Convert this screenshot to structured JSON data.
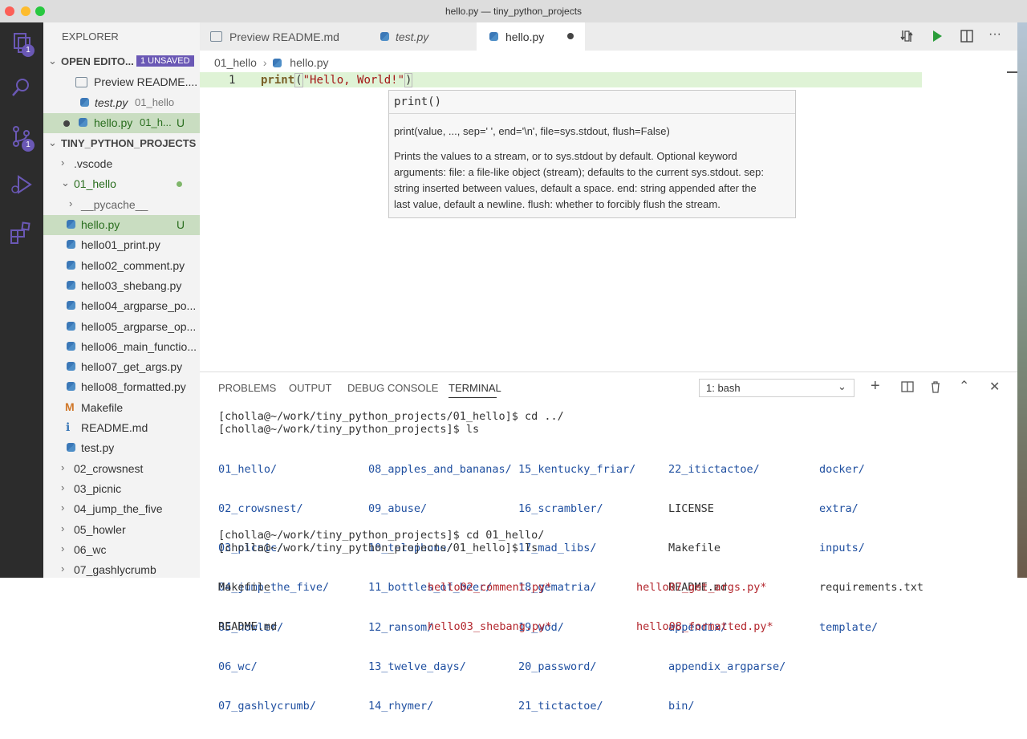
{
  "window": {
    "title": "hello.py — tiny_python_projects"
  },
  "activity": {
    "explorer_badge": "1",
    "scm_badge": "1"
  },
  "sidebar": {
    "header": "EXPLORER",
    "open_editors": {
      "label": "OPEN EDITO...",
      "unsaved_badge": "1 UNSAVED",
      "items": [
        {
          "name": "Preview README....",
          "detail": "",
          "status": ""
        },
        {
          "name": "test.py",
          "detail": "01_hello",
          "status": ""
        },
        {
          "name": "hello.py",
          "detail": "01_h...",
          "status": "U"
        }
      ]
    },
    "project": {
      "label": "TINY_PYTHON_PROJECTS",
      "items": [
        {
          "name": ".vscode"
        },
        {
          "name": "01_hello"
        },
        {
          "name": "__pycache__"
        },
        {
          "name": "hello.py",
          "status": "U"
        },
        {
          "name": "hello01_print.py"
        },
        {
          "name": "hello02_comment.py"
        },
        {
          "name": "hello03_shebang.py"
        },
        {
          "name": "hello04_argparse_po..."
        },
        {
          "name": "hello05_argparse_op..."
        },
        {
          "name": "hello06_main_functio..."
        },
        {
          "name": "hello07_get_args.py"
        },
        {
          "name": "hello08_formatted.py"
        },
        {
          "name": "Makefile"
        },
        {
          "name": "README.md"
        },
        {
          "name": "test.py"
        },
        {
          "name": "02_crowsnest"
        },
        {
          "name": "03_picnic"
        },
        {
          "name": "04_jump_the_five"
        },
        {
          "name": "05_howler"
        },
        {
          "name": "06_wc"
        },
        {
          "name": "07_gashlycrumb"
        }
      ]
    }
  },
  "tabs": [
    {
      "label": "Preview README.md"
    },
    {
      "label": "test.py"
    },
    {
      "label": "hello.py"
    }
  ],
  "breadcrumb": {
    "folder": "01_hello",
    "file": "hello.py"
  },
  "editor": {
    "line_number": "1",
    "code_func": "print",
    "code_open": "(",
    "code_string": "\"Hello, World!\"",
    "code_close": ")"
  },
  "hover": {
    "title": "print()",
    "signature": "print(value, ..., sep=' ', end='\\n', file=sys.stdout, flush=False)",
    "doc_lines": [
      "Prints the values to a stream, or to sys.stdout by default. Optional keyword",
      "arguments: file: a file-like object (stream); defaults to the current sys.stdout. sep:",
      "string inserted between values, default a space. end: string appended after the",
      "last value, default a newline. flush: whether to forcibly flush the stream."
    ]
  },
  "panel": {
    "tabs": [
      "PROBLEMS",
      "OUTPUT",
      "DEBUG CONSOLE",
      "TERMINAL"
    ],
    "terminal_select": "1: bash",
    "terminal": {
      "line1": "[cholla@~/work/tiny_python_projects/01_hello]$ cd ../",
      "line2": "[cholla@~/work/tiny_python_projects]$ ls",
      "ls_columns": [
        [
          "01_hello/",
          "02_crowsnest/",
          "03_picnic/",
          "04_jump_the_five/",
          "05_howler/",
          "06_wc/",
          "07_gashlycrumb/"
        ],
        [
          "08_apples_and_bananas/",
          "09_abuse/",
          "10_telephone/",
          "11_bottles_of_beer/",
          "12_ransom/",
          "13_twelve_days/",
          "14_rhymer/"
        ],
        [
          "15_kentucky_friar/",
          "16_scrambler/",
          "17_mad_libs/",
          "18_gematria/",
          "19_wod/",
          "20_password/",
          "21_tictactoe/"
        ],
        [
          "22_itictactoe/",
          "LICENSE",
          "Makefile",
          "README.md",
          "appendix/",
          "appendix_argparse/",
          "bin/"
        ],
        [
          "docker/",
          "extra/",
          "inputs/",
          "requirements.txt",
          "template/"
        ]
      ],
      "line3": "[cholla@~/work/tiny_python_projects]$ cd 01_hello/",
      "line4": "[cholla@~/work/tiny_python_projects/01_hello]$ ls",
      "ls2_columns": [
        [
          "Makefile",
          "README.md"
        ],
        [
          "hello02_comment.py*",
          "hello03_shebang.py*"
        ],
        [
          "hello07_get_args.py*",
          "hello08_formatted.py*"
        ]
      ]
    }
  },
  "colors": {
    "activity_bg": "#2c2c2c",
    "sidebar_bg": "#f3f3f3",
    "selection_green": "#c9ddc1",
    "accent_purple": "#6a58b5",
    "dir_blue": "#1f4fa0",
    "exec_red": "#b3272e"
  }
}
